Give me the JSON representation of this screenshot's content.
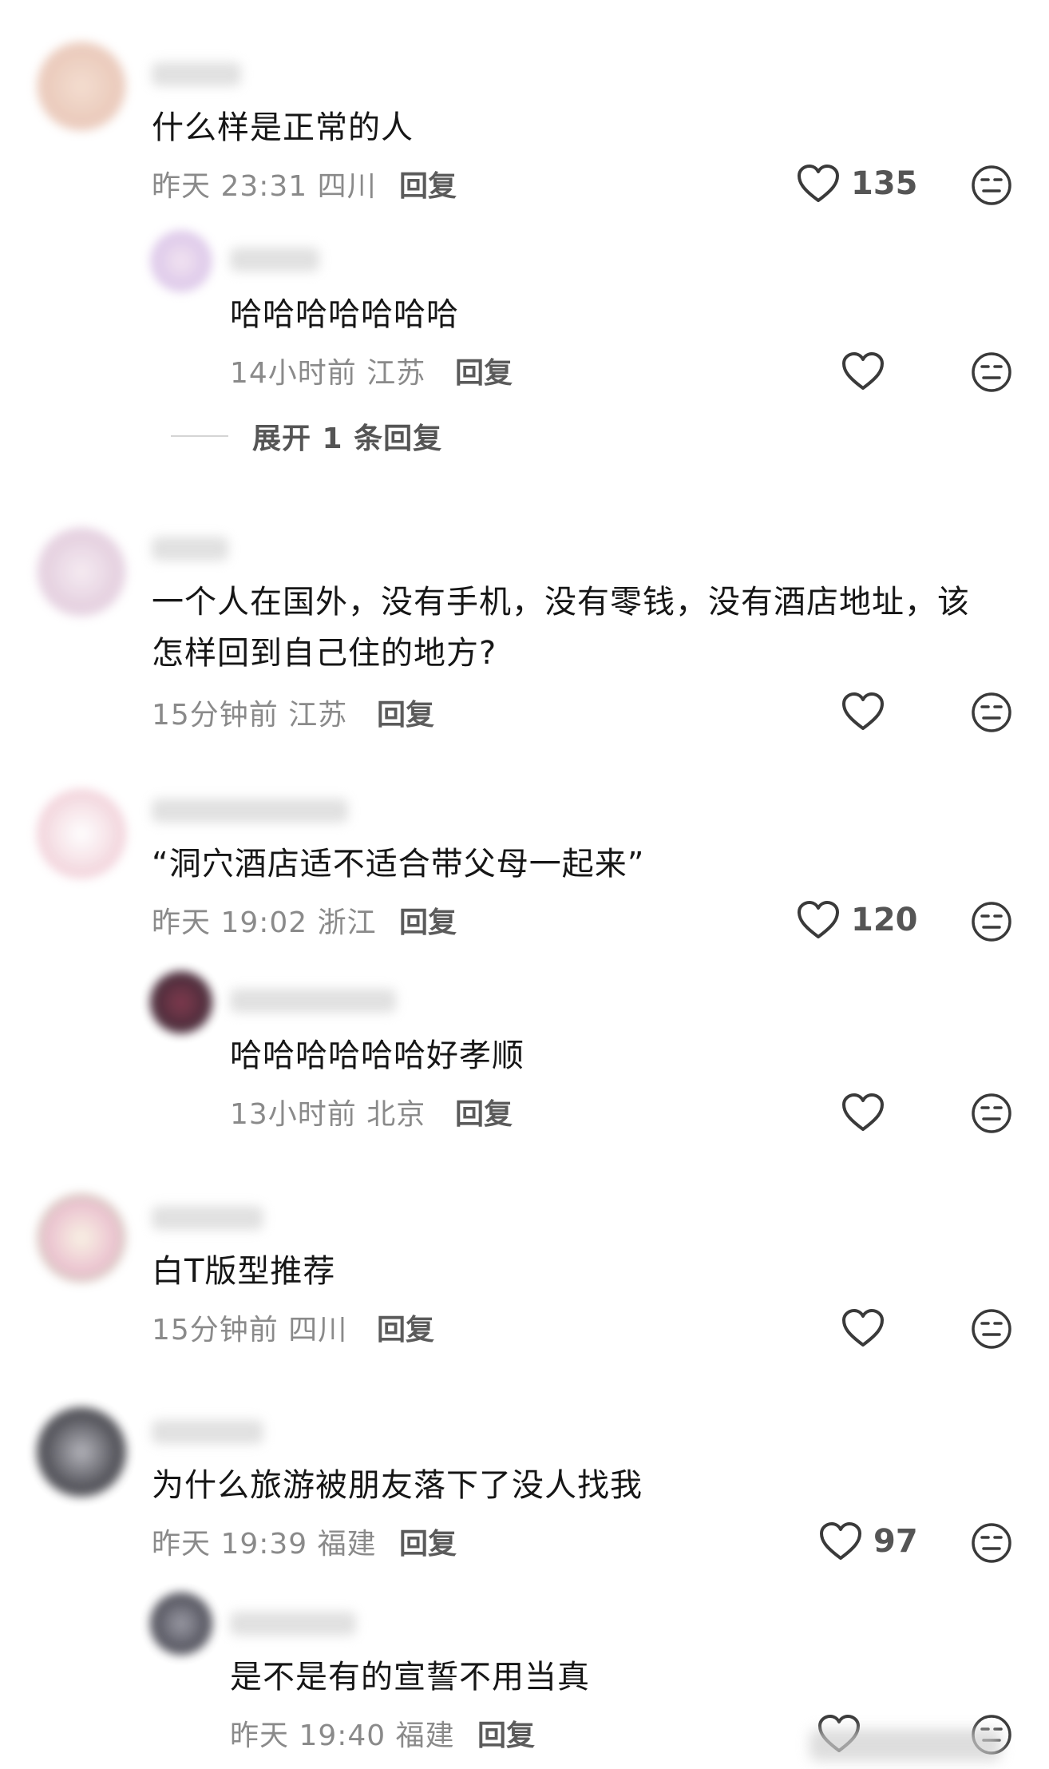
{
  "comments": [
    {
      "text": "什么样是正常的人",
      "meta": "昨天 23:31 四川",
      "reply_label": "回复",
      "likes": "135",
      "replies": [
        {
          "text": "哈哈哈哈哈哈哈",
          "meta": "14小时前 江苏",
          "reply_label": "回复"
        }
      ],
      "expand_label": "展开 1 条回复"
    },
    {
      "text": "一个人在国外，没有手机，没有零钱，没有酒店地址，该\n怎样回到自己住的地方?",
      "meta": "15分钟前 江苏",
      "reply_label": "回复"
    },
    {
      "text": "“洞穴酒店适不适合带父母一起来”",
      "meta": "昨天 19:02 浙江",
      "reply_label": "回复",
      "likes": "120",
      "replies": [
        {
          "text": "哈哈哈哈哈哈好孝顺",
          "meta": "13小时前 北京",
          "reply_label": "回复"
        }
      ]
    },
    {
      "text": "白T版型推荐",
      "meta": "15分钟前 四川",
      "reply_label": "回复"
    },
    {
      "text": "为什么旅游被朋友落下了没人找我",
      "meta": "昨天 19:39 福建",
      "reply_label": "回复",
      "likes": "97",
      "replies": [
        {
          "text": "是不是有的宣誓不用当真",
          "meta": "昨天 19:40 福建",
          "reply_label": "回复"
        }
      ]
    }
  ],
  "icons": {
    "like": "heart-outline-icon",
    "dislike": "unhappy-face-icon"
  },
  "colors": {
    "text": "#161616",
    "meta": "#8a8a8a",
    "icon": "#3a3a3a"
  }
}
